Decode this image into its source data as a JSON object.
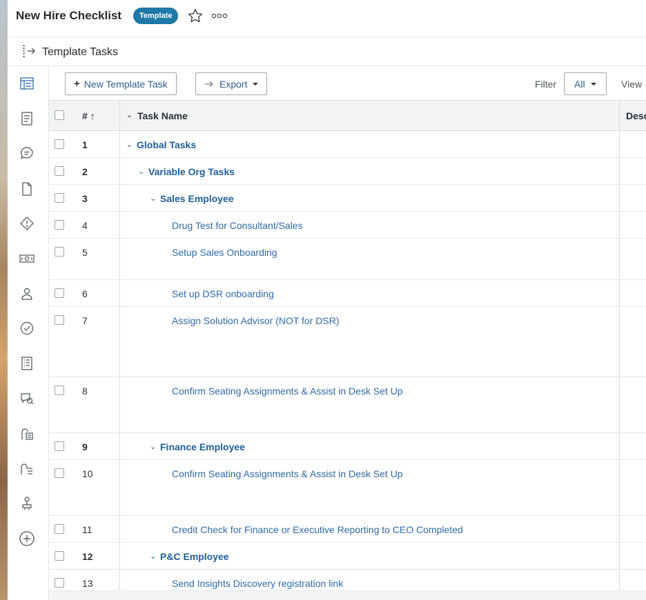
{
  "header": {
    "title": "New Hire Checklist",
    "badge": "Template"
  },
  "subheader": {
    "title": "Template Tasks"
  },
  "rail": {
    "items": [
      "tasks-icon",
      "document-icon",
      "chat-icon",
      "file-icon",
      "risk-icon",
      "money-icon",
      "people-icon",
      "approval-icon",
      "report-icon",
      "review-icon",
      "form-icon",
      "checklist-icon",
      "workflow-icon",
      "add-icon"
    ]
  },
  "toolbar": {
    "new_task_label": "New Template Task",
    "export_label": "Export",
    "filter_label": "Filter",
    "filter_value": "All",
    "view_label": "View"
  },
  "table": {
    "columns": {
      "number": "# ↑",
      "name": "Task Name",
      "description": "Desc"
    },
    "rows": [
      {
        "num": "1",
        "name": "Global Tasks",
        "group": true
      },
      {
        "num": "2",
        "name": "Variable Org Tasks",
        "group": true
      },
      {
        "num": "3",
        "name": "Sales Employee",
        "group": true
      },
      {
        "num": "4",
        "name": "Drug Test for Consultant/Sales",
        "group": false
      },
      {
        "num": "5",
        "name": "Setup Sales Onboarding",
        "group": false
      },
      {
        "num": "6",
        "name": "Set up DSR onboarding",
        "group": false
      },
      {
        "num": "7",
        "name": "Assign Solution Advisor (NOT for DSR)",
        "group": false
      },
      {
        "num": "8",
        "name": "Confirm Seating Assignments & Assist in Desk Set Up",
        "group": false
      },
      {
        "num": "9",
        "name": "Finance Employee",
        "group": true
      },
      {
        "num": "10",
        "name": "Confirm Seating Assignments & Assist in Desk Set Up",
        "group": false
      },
      {
        "num": "11",
        "name": "Credit Check for Finance or Executive Reporting to CEO Completed",
        "group": false
      },
      {
        "num": "12",
        "name": "P&C Employee",
        "group": true
      },
      {
        "num": "13",
        "name": "Send Insights Discovery registration link",
        "group": false
      }
    ]
  }
}
